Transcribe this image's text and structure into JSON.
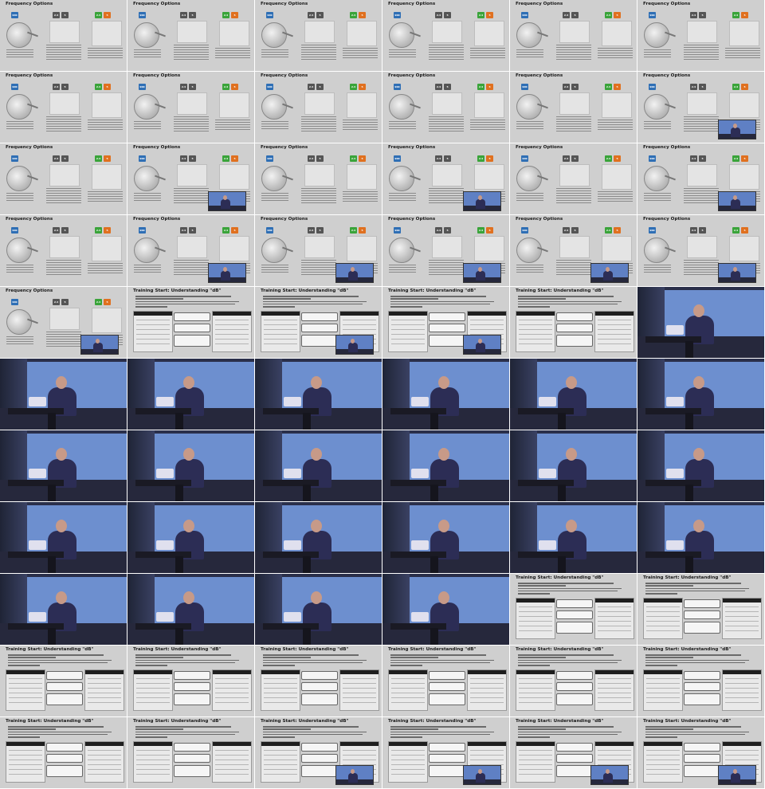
{
  "slides": {
    "frequency": {
      "title": "Frequency Options",
      "badge_a": "900",
      "badge_b": "2.4",
      "badge_c": "5"
    },
    "db": {
      "title": "Training Start: Understanding \"dB\""
    }
  },
  "grid": {
    "columns": 6,
    "rows": 11,
    "cells": [
      "F",
      "F",
      "F",
      "F",
      "F",
      "F",
      "F",
      "F",
      "F",
      "F",
      "F",
      "FP",
      "F",
      "FP",
      "F",
      "FP",
      "F",
      "FP",
      "F",
      "FP",
      "FP",
      "FP",
      "FP",
      "FP",
      "FP",
      "D",
      "DP",
      "DP",
      "D",
      "V",
      "V",
      "V",
      "V",
      "V",
      "V",
      "V",
      "V",
      "V",
      "V",
      "V",
      "V",
      "V",
      "V",
      "V",
      "V",
      "V",
      "V",
      "V",
      "V",
      "V",
      "V",
      "V",
      "D",
      "D",
      "D",
      "D",
      "D",
      "D",
      "D",
      "D",
      "D",
      "D",
      "DP",
      "DP",
      "DP",
      "DP"
    ]
  }
}
